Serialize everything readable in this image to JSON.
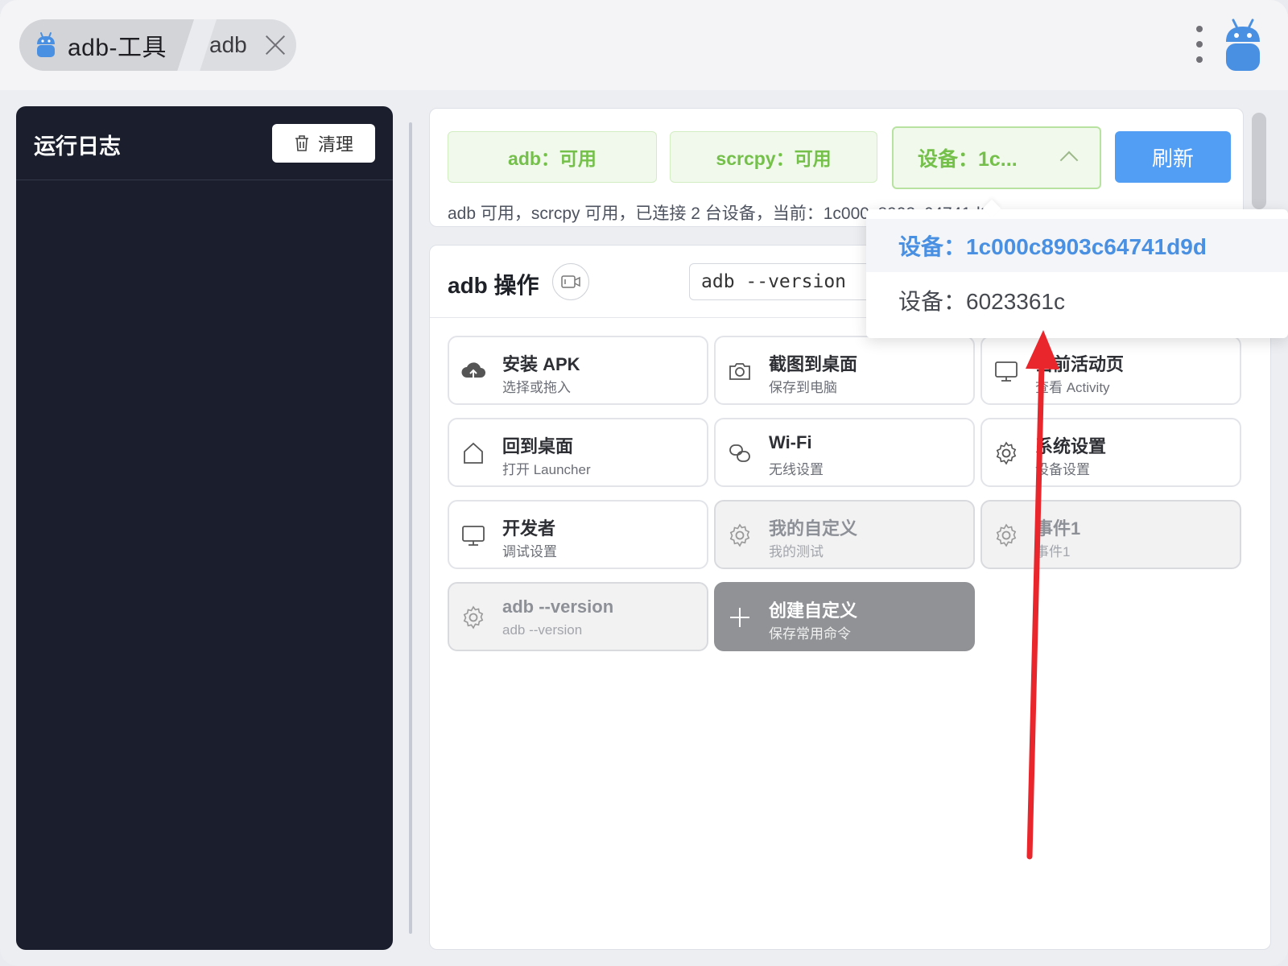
{
  "titlebar": {
    "app_title": "adb-工具",
    "sub_tab": "adb"
  },
  "log": {
    "title": "运行日志",
    "clear_label": "清理"
  },
  "status": {
    "adb_pill": "adb：可用",
    "scrcpy_pill": "scrcpy：可用",
    "device_select": "设备：1c...",
    "refresh_label": "刷新",
    "summary": "adb 可用，scrcpy 可用，已连接 2 台设备，当前：1c000c8903c64741d9d"
  },
  "device_dropdown": {
    "options": [
      {
        "label": "设备：1c000c8903c64741d9d",
        "selected": true
      },
      {
        "label": "设备：6023361c",
        "selected": false
      }
    ]
  },
  "ops": {
    "title": "adb 操作",
    "command_value": "adb --version",
    "cards": [
      {
        "title": "安装 APK",
        "sub": "选择或拖入",
        "icon": "cloud-upload-icon",
        "style": "normal"
      },
      {
        "title": "截图到桌面",
        "sub": "保存到电脑",
        "icon": "camera-icon",
        "style": "normal"
      },
      {
        "title": "当前活动页",
        "sub": "查看 Activity",
        "icon": "monitor-icon",
        "style": "normal"
      },
      {
        "title": "回到桌面",
        "sub": "打开 Launcher",
        "icon": "home-icon",
        "style": "normal"
      },
      {
        "title": "Wi-Fi",
        "sub": "无线设置",
        "icon": "link-icon",
        "style": "normal"
      },
      {
        "title": "系统设置",
        "sub": "设备设置",
        "icon": "gear-icon",
        "style": "normal"
      },
      {
        "title": "开发者",
        "sub": "调试设置",
        "icon": "monitor-icon",
        "style": "normal"
      },
      {
        "title": "我的自定义",
        "sub": "我的测试",
        "icon": "gear-icon",
        "style": "gray"
      },
      {
        "title": "事件1",
        "sub": "事件1",
        "icon": "gear-icon",
        "style": "gray"
      },
      {
        "title": "adb --version",
        "sub": "adb --version",
        "icon": "gear-icon",
        "style": "gray"
      },
      {
        "title": "创建自定义",
        "sub": "保存常用命令",
        "icon": "plus-icon",
        "style": "dark"
      }
    ]
  },
  "colors": {
    "accent_blue": "#529ef5",
    "success_green": "#74c04a",
    "log_bg": "#1b1f2d",
    "annotation_red": "#e8262b"
  }
}
